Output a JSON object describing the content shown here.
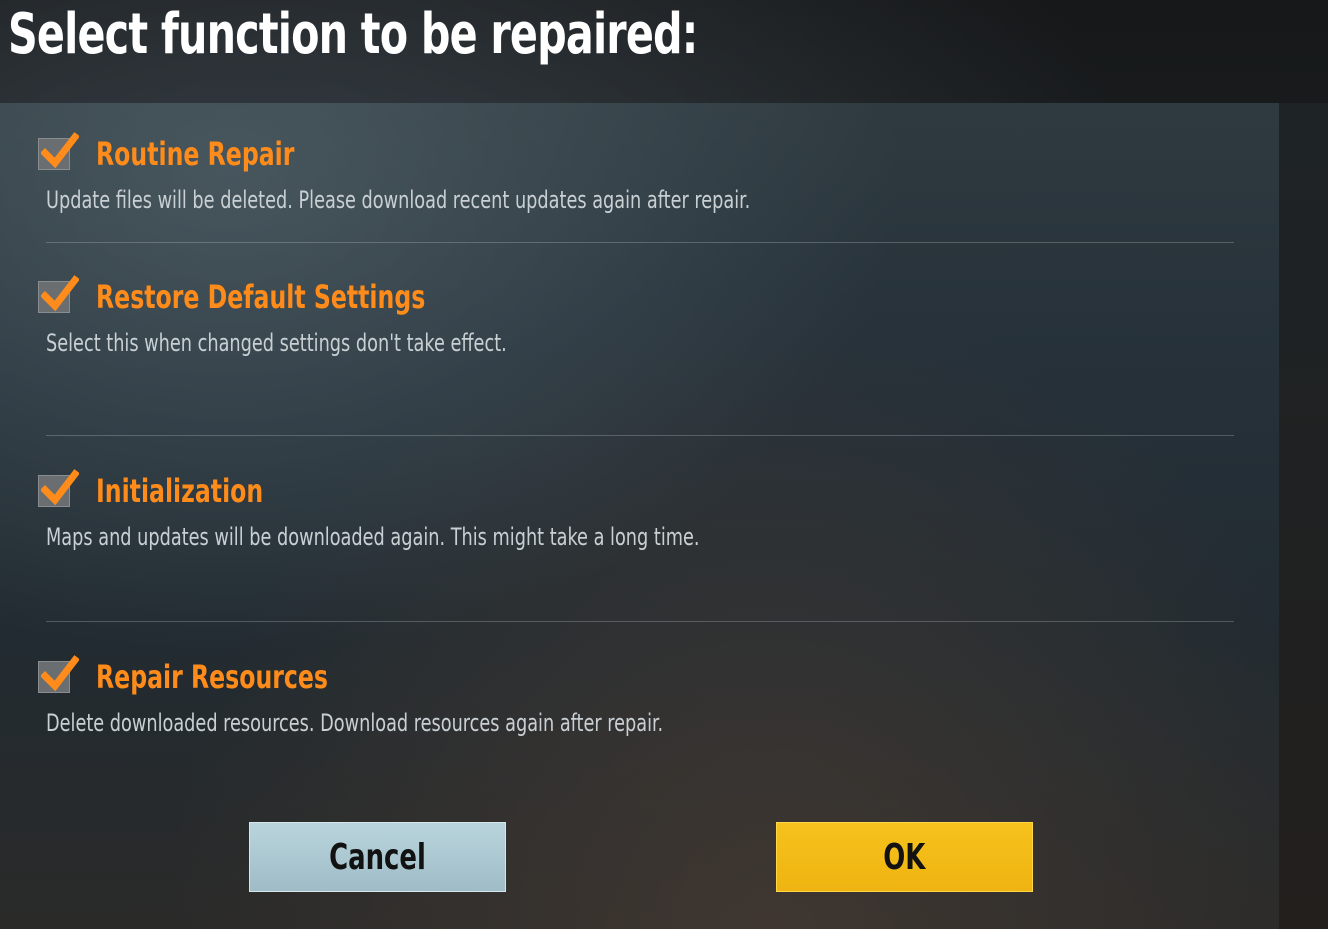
{
  "dialog": {
    "title": "Select function to be repaired:"
  },
  "options": [
    {
      "label": "Routine Repair",
      "description": "Update files will be deleted. Please download recent updates again after repair.",
      "checked": true
    },
    {
      "label": "Restore Default Settings",
      "description": "Select this when changed settings don't take effect.",
      "checked": true
    },
    {
      "label": "Initialization",
      "description": "Maps and updates will be downloaded again. This might take a long time.",
      "checked": true
    },
    {
      "label": "Repair Resources",
      "description": "Delete downloaded resources. Download resources again after repair.",
      "checked": true
    }
  ],
  "buttons": {
    "cancel_label": "Cancel",
    "ok_label": "OK"
  },
  "colors": {
    "accent": "#ff8c1a",
    "ok_button": "#f4bd1a",
    "cancel_button": "#abc8d2",
    "description_text": "#c9d0d4"
  }
}
